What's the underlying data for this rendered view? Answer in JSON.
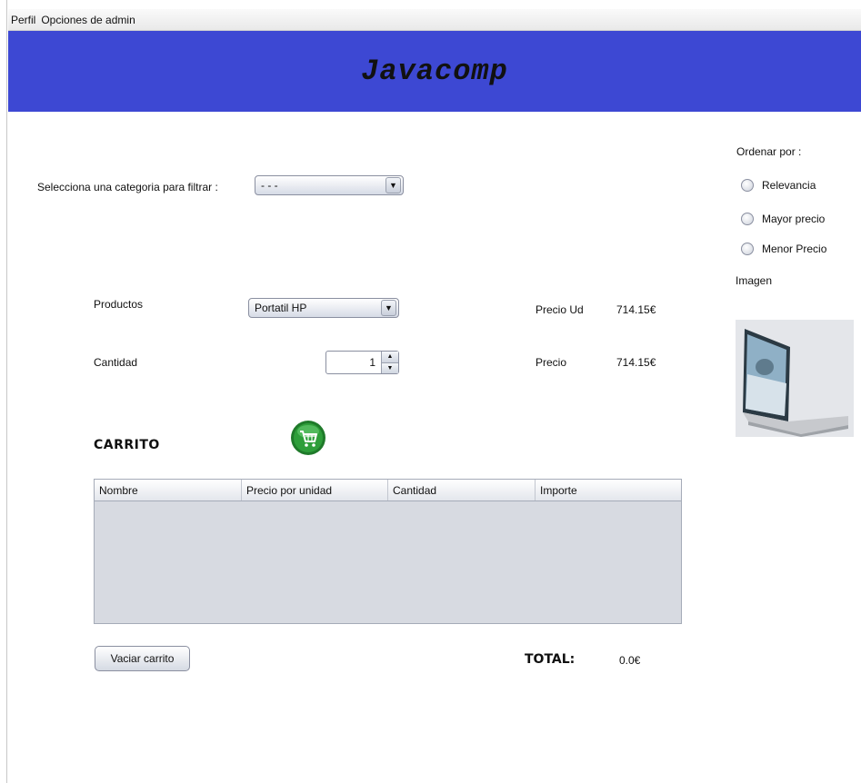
{
  "menubar": {
    "items": [
      "Perfil",
      "Opciones de admin"
    ]
  },
  "banner": {
    "title": "Javacomp"
  },
  "filter": {
    "label": "Selecciona una categoria para filtrar :",
    "selected": "- - -"
  },
  "sort": {
    "label": "Ordenar por :",
    "options": [
      "Relevancia",
      "Mayor precio",
      "Menor Precio"
    ]
  },
  "image": {
    "label": "Imagen"
  },
  "product": {
    "label": "Productos",
    "selected": "Portatil HP",
    "unit_price_label": "Precio Ud",
    "unit_price_value": "714.15€"
  },
  "quantity": {
    "label": "Cantidad",
    "value": "1",
    "price_label": "Precio",
    "price_value": "714.15€"
  },
  "cart": {
    "heading": "CARRITO",
    "columns": [
      "Nombre",
      "Precio por unidad",
      "Cantidad",
      "Importe"
    ],
    "rows": []
  },
  "actions": {
    "empty_cart_label": "Vaciar carrito"
  },
  "totals": {
    "label": "TOTAL:",
    "value": "0.0€"
  },
  "colors": {
    "banner": "#3d48d3",
    "cart_icon": "#2e9e3a"
  },
  "icons": {
    "cart": "shopping-cart-icon",
    "dropdown": "chevron-down-icon"
  }
}
